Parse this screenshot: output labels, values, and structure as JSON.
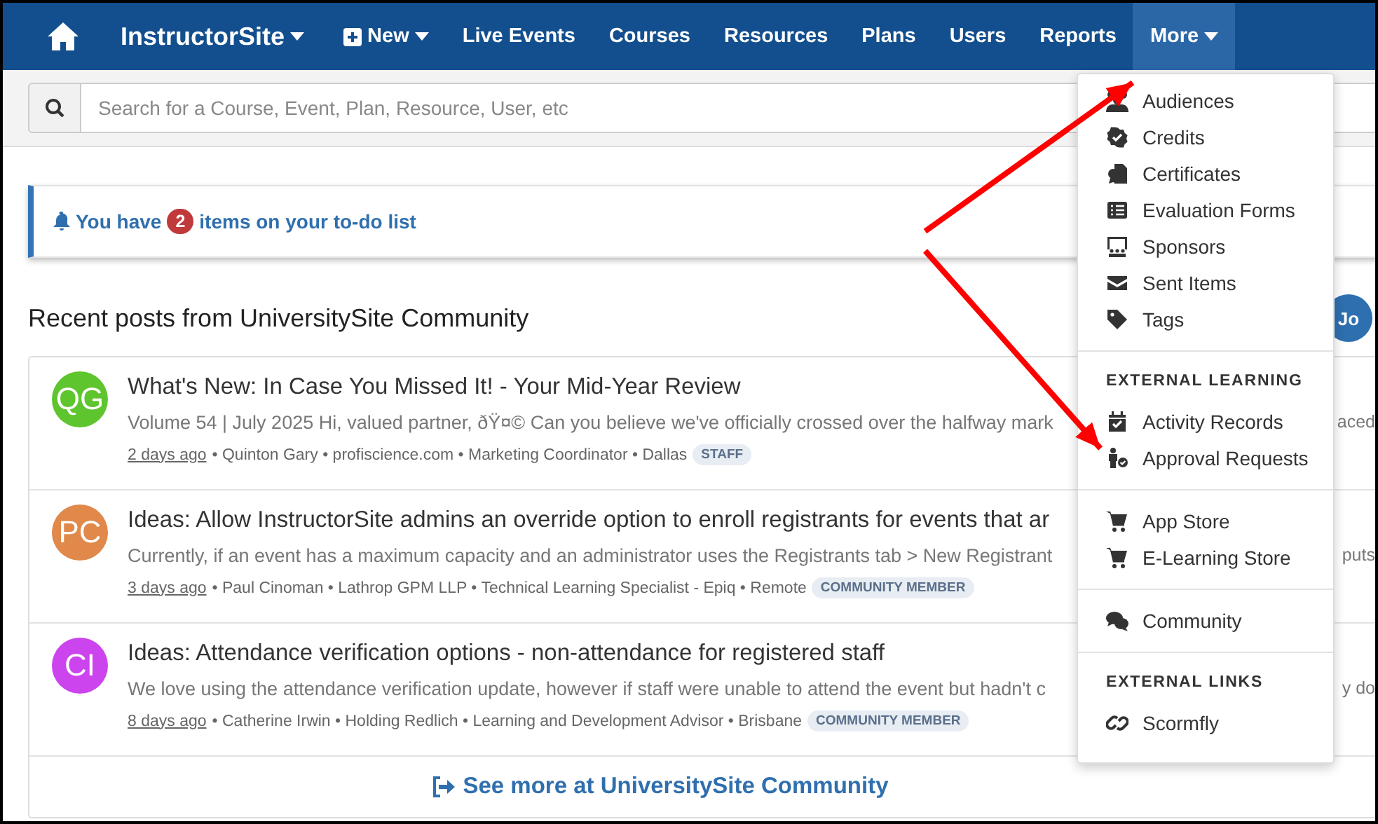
{
  "nav": {
    "items": [
      {
        "kind": "home",
        "selected": false
      },
      {
        "kind": "brand",
        "label": "InstructorSite",
        "selected": false,
        "caret": true
      },
      {
        "kind": "new",
        "label": "New",
        "selected": false,
        "caret": true
      },
      {
        "kind": "link",
        "label": "Live Events",
        "selected": false
      },
      {
        "kind": "link",
        "label": "Courses",
        "selected": false
      },
      {
        "kind": "link",
        "label": "Resources",
        "selected": false
      },
      {
        "kind": "link",
        "label": "Plans",
        "selected": false
      },
      {
        "kind": "link",
        "label": "Users",
        "selected": false
      },
      {
        "kind": "link",
        "label": "Reports",
        "selected": false
      },
      {
        "kind": "link",
        "label": "More",
        "selected": true,
        "caret": true
      }
    ]
  },
  "search": {
    "placeholder": "Search for a Course, Event, Plan, Resource, User, etc"
  },
  "todo": {
    "before": "You have",
    "count": "2",
    "after": "items on your to-do list"
  },
  "community": {
    "heading": "Recent posts from UniversitySite Community",
    "user_button": "Jo",
    "posts": [
      {
        "initials": "QG",
        "color": "#5fc52e",
        "title": "What's New: In Case You Missed It! - Your Mid-Year Review",
        "excerpt": "Volume 54 | July 2025 Hi, valued partner, ðŸ¤© Can you believe we've officially crossed over the halfway mark",
        "excerpt_tail": "aced",
        "time": "2 days ago",
        "meta": "• Quinton Gary • profiscience.com • Marketing Coordinator • Dallas",
        "badge": "STAFF"
      },
      {
        "initials": "PC",
        "color": "#e0894a",
        "title": "Ideas: Allow InstructorSite admins an override option to enroll registrants for events that ar",
        "excerpt": "Currently, if an event has a maximum capacity and an administrator uses the Registrants tab > New Registrant",
        "excerpt_tail": "puts",
        "time": "3 days ago",
        "meta": "• Paul Cinoman • Lathrop GPM LLP • Technical Learning Specialist - Epiq • Remote",
        "badge": "COMMUNITY MEMBER"
      },
      {
        "initials": "CI",
        "color": "#cc44ee",
        "title": "Ideas: Attendance verification options - non-attendance for registered staff",
        "excerpt": "We love using the attendance verification update, however if staff were unable to attend the event but hadn't c",
        "excerpt_tail": "y do",
        "time": "8 days ago",
        "meta": "• Catherine Irwin • Holding Redlich • Learning and Development Advisor • Brisbane",
        "badge": "COMMUNITY MEMBER"
      }
    ],
    "see_more": "See more at UniversitySite Community"
  },
  "more_menu": {
    "sections": [
      {
        "items": [
          "Audiences",
          "Credits",
          "Certificates",
          "Evaluation Forms",
          "Sponsors",
          "Sent Items",
          "Tags"
        ]
      },
      {
        "heading": "EXTERNAL LEARNING",
        "items": [
          "Activity Records",
          "Approval Requests"
        ]
      },
      {
        "items": [
          "App Store",
          "E-Learning Store"
        ]
      },
      {
        "items": [
          "Community"
        ]
      },
      {
        "heading": "EXTERNAL LINKS",
        "items": [
          "Scormfly"
        ]
      }
    ]
  }
}
